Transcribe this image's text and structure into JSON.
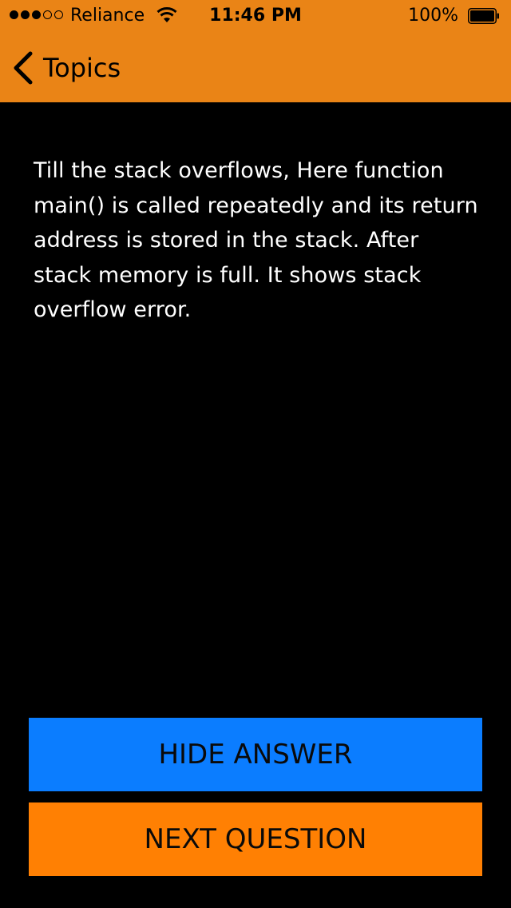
{
  "status_bar": {
    "carrier": "Reliance",
    "time": "11:46 PM",
    "battery_percent": "100%",
    "signal_strength": 3,
    "signal_total": 5,
    "battery_level": 1.0
  },
  "nav": {
    "back_label": "Topics",
    "back_icon": "chevron-left-icon"
  },
  "answer": {
    "text": "Till the stack overflows, Here function main() is called repeatedly and its return address is stored in the stack. After stack memory is full. It shows stack overflow error."
  },
  "buttons": {
    "hide_answer": "HIDE ANSWER",
    "next_question": "NEXT QUESTION"
  },
  "colors": {
    "header": "#ea8416",
    "background": "#000000",
    "hide_button": "#0b7dff",
    "next_button": "#ff8003",
    "answer_text": "#ffffff"
  }
}
